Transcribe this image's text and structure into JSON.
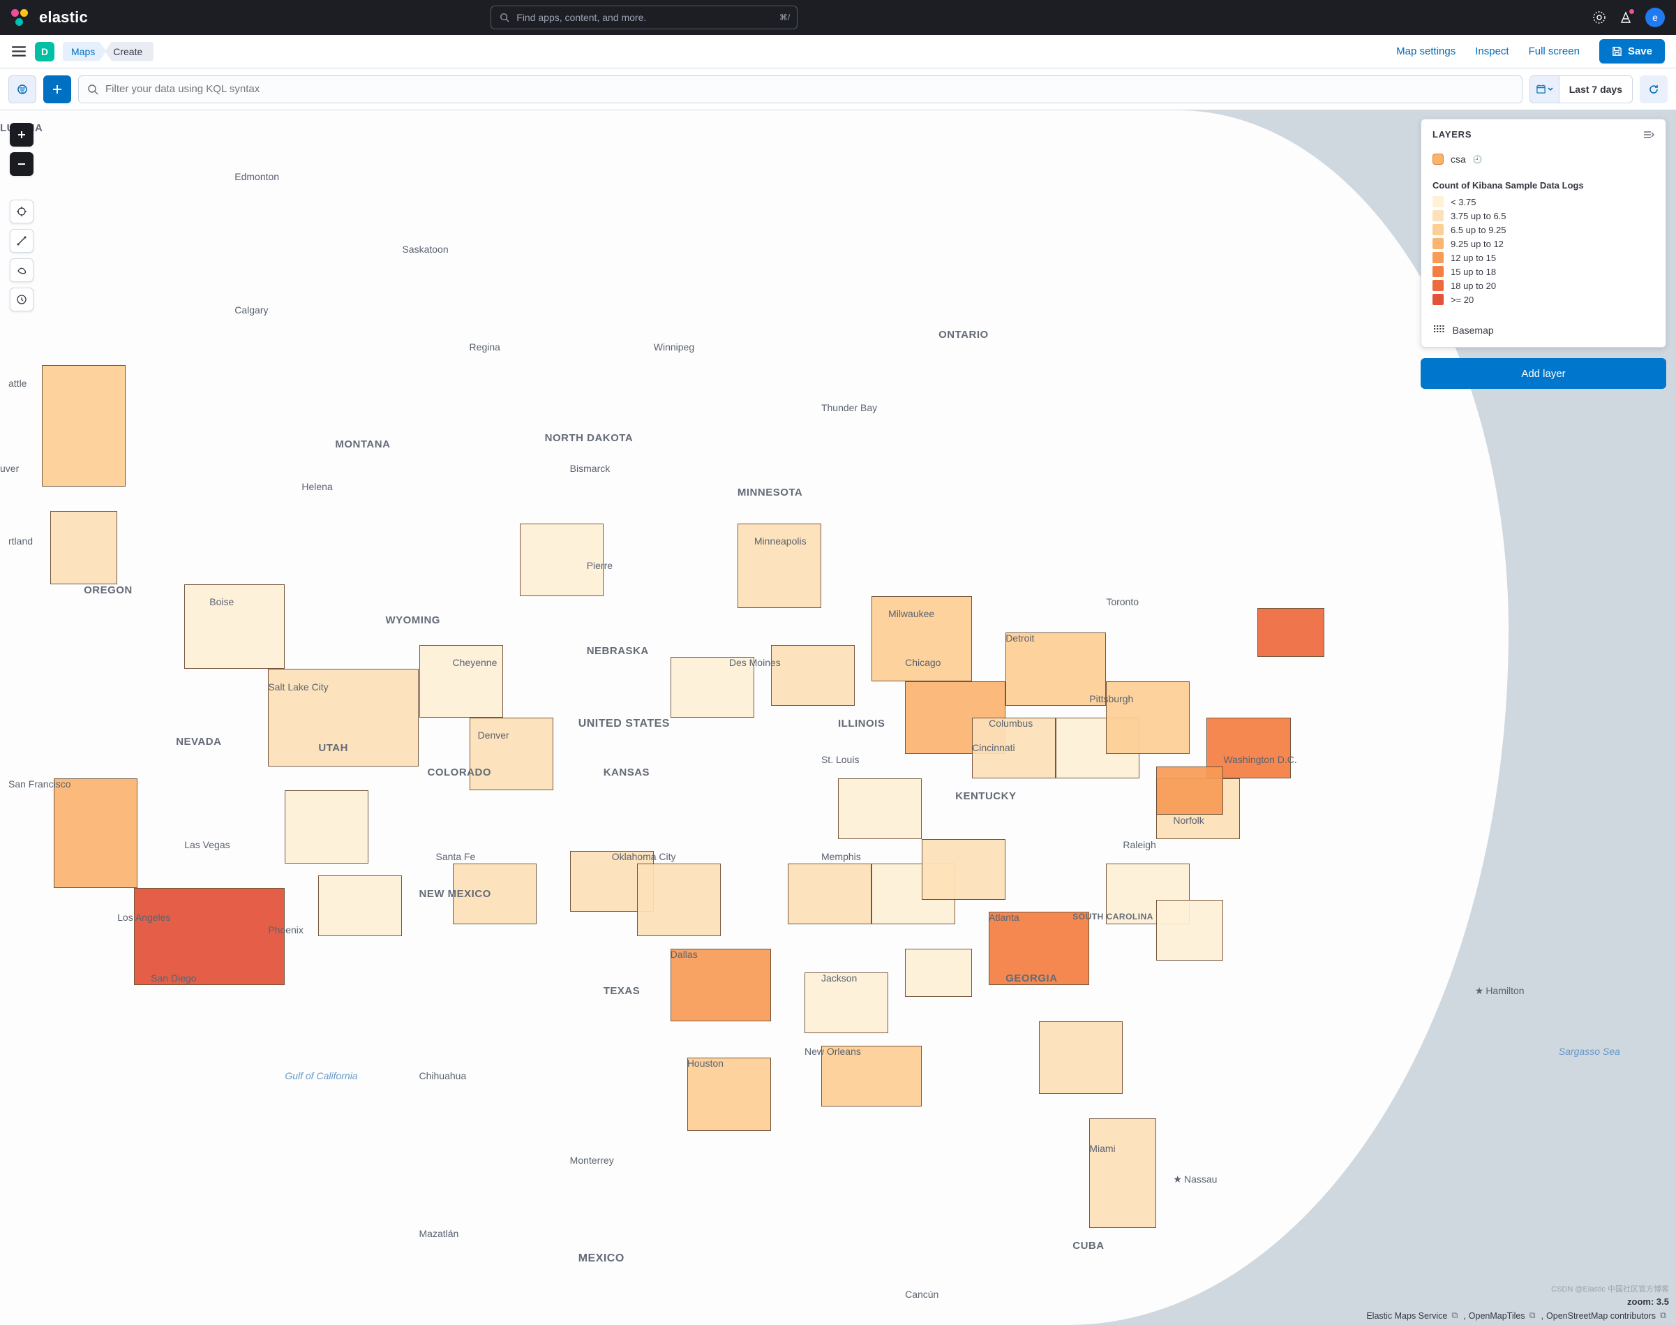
{
  "brand": "elastic",
  "search": {
    "placeholder": "Find apps, content, and more.",
    "shortcut": "⌘/"
  },
  "avatar_letter": "e",
  "space_letter": "D",
  "breadcrumbs": {
    "app": "Maps",
    "current": "Create"
  },
  "subnav": {
    "map_settings": "Map settings",
    "inspect": "Inspect",
    "fullscreen": "Full screen",
    "save": "Save"
  },
  "query": {
    "placeholder": "Filter your data using KQL syntax",
    "time_range": "Last 7 days"
  },
  "layers_panel": {
    "title": "LAYERS",
    "layer_name": "csa",
    "legend_title": "Count of Kibana Sample Data Logs",
    "legend": [
      {
        "color": "#fff1d8",
        "label": "< 3.75"
      },
      {
        "color": "#fde1b8",
        "label": "3.75 up to 6.5"
      },
      {
        "color": "#fdcf95",
        "label": "6.5 up to 9.25"
      },
      {
        "color": "#fbb570",
        "label": "9.25 up to 12"
      },
      {
        "color": "#f89b56",
        "label": "12 up to 15"
      },
      {
        "color": "#f47f42",
        "label": "15 up to 18"
      },
      {
        "color": "#ed6a3e",
        "label": "18 up to 20"
      },
      {
        "color": "#e45239",
        "label": ">= 20"
      }
    ],
    "basemap": "Basemap",
    "add_layer": "Add layer"
  },
  "map_labels": {
    "edmonton": "Edmonton",
    "saskatoon": "Saskatoon",
    "calgary": "Calgary",
    "regina": "Regina",
    "winnipeg": "Winnipeg",
    "ontario": "ONTARIO",
    "thunder_bay": "Thunder Bay",
    "toronto": "Toronto",
    "montana": "MONTANA",
    "nd": "NORTH DAKOTA",
    "helena": "Helena",
    "bismarck": "Bismarck",
    "minnesota": "MINNESOTA",
    "minneapolis": "Minneapolis",
    "oregon": "OREGON",
    "boise": "Boise",
    "pierre": "Pierre",
    "milwaukee": "Milwaukee",
    "wyoming": "WYOMING",
    "nebraska": "NEBRASKA",
    "chicago": "Chicago",
    "detroit": "Detroit",
    "slc": "Salt Lake City",
    "cheyenne": "Cheyenne",
    "des_moines": "Des Moines",
    "us": "UNITED STATES",
    "nevada": "NEVADA",
    "utah": "UTAH",
    "denver": "Denver",
    "illinois": "ILLINOIS",
    "columbus": "Columbus",
    "cincinnati": "Cincinnati",
    "pittsburgh": "Pittsburgh",
    "dc": "Washington D.C.",
    "sf": "San Francisco",
    "colorado": "COLORADO",
    "kansas": "KANSAS",
    "stlouis": "St. Louis",
    "kentucky": "KENTUCKY",
    "norfolk": "Norfolk",
    "lv": "Las Vegas",
    "santafe": "Santa Fe",
    "okc": "Oklahoma City",
    "memphis": "Memphis",
    "raleigh": "Raleigh",
    "la": "Los Angeles",
    "phoenix": "Phoenix",
    "nm": "NEW MEXICO",
    "atlanta": "Atlanta",
    "sc": "SOUTH CAROLINA",
    "sd": "San Diego",
    "texas": "TEXAS",
    "dallas": "Dallas",
    "jackson": "Jackson",
    "georgia": "GEORGIA",
    "hamilton": "Hamilton",
    "gulf": "Gulf of California",
    "chihuahua": "Chihuahua",
    "houston": "Houston",
    "neworleans": "New Orleans",
    "sargasso": "Sargasso Sea",
    "monterrey": "Monterrey",
    "miami": "Miami",
    "nassau": "Nassau",
    "mazatlan": "Mazatlán",
    "mexico": "MEXICO",
    "cuba": "CUBA",
    "cancun": "Cancún",
    "columbia_partial": "LUMBIA",
    "uver": "uver",
    "rtland": "rtland",
    "attle": "attle"
  },
  "zoom": {
    "label": "zoom:",
    "value": "3.5"
  },
  "attribution": {
    "ems": "Elastic Maps Service",
    "omt": "OpenMapTiles",
    "osm": "OpenStreetMap contributors"
  },
  "watermark": "CSDN @Elastic 中国社区官方博客"
}
